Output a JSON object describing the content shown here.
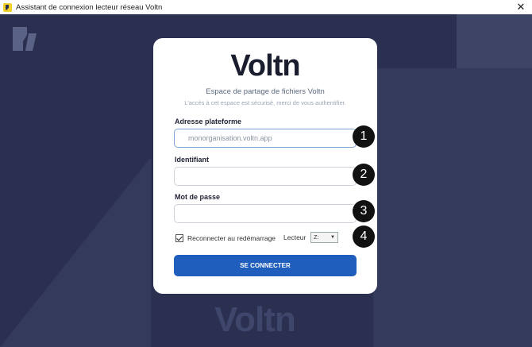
{
  "window": {
    "title": "Assistant de connexion lecteur réseau Voltn",
    "close_glyph": "✕"
  },
  "background": {
    "watermark": "Voltn"
  },
  "card": {
    "brand": "Voltn",
    "subtitle": "Espace de partage de fichiers Voltn",
    "hint": "L'accès à cet espace est sécurisé, merci de vous authentifier.",
    "fields": {
      "platform": {
        "label": "Adresse plateforme",
        "placeholder": "monorganisation.voltn.app",
        "value": ""
      },
      "username": {
        "label": "Identifiant",
        "value": ""
      },
      "password": {
        "label": "Mot de passe",
        "value": ""
      }
    },
    "reconnect": {
      "label": "Reconnecter au redémarrage",
      "checked": true
    },
    "drive": {
      "label": "Lecteur",
      "selected": "Z:"
    },
    "submit_label": "SE CONNECTER"
  },
  "badges": [
    "1",
    "2",
    "3",
    "4"
  ],
  "colors": {
    "background": "#2b3050",
    "primary_button": "#1f5ebd",
    "brand_text": "#1a1d2e"
  }
}
